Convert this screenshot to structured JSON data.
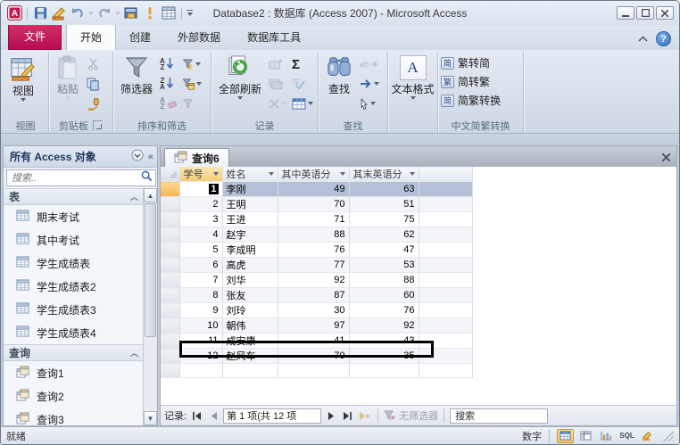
{
  "window": {
    "title": "Database2 : 数据库 (Access 2007)  -  Microsoft Access"
  },
  "qat_icons": [
    "access-logo",
    "save",
    "design-view",
    "undo",
    "redo",
    "switch-windows",
    "run",
    "datasheet-view",
    "customize-qat"
  ],
  "tabs": {
    "file": "文件",
    "items": [
      "开始",
      "创建",
      "外部数据",
      "数据库工具"
    ],
    "active": "开始"
  },
  "ribbon": {
    "views": {
      "button": "视图",
      "label": "视图"
    },
    "clipboard": {
      "paste": "粘贴",
      "label": "剪贴板"
    },
    "sort_filter": {
      "filter": "筛选器",
      "label": "排序和筛选"
    },
    "records": {
      "refresh": "全部刷新",
      "label": "记录",
      "sigma": "Σ"
    },
    "find": {
      "find": "查找",
      "label": "查找",
      "replace": "ab"
    },
    "text_format": {
      "button": "文本格式",
      "letter": "A"
    },
    "chinese": {
      "t2s": "繁转简",
      "s2t": "简转繁",
      "convert": "简繁转换",
      "label": "中文简繁转换",
      "icon_t2s": "简",
      "icon_s2t": "繁",
      "icon_convert": "简"
    }
  },
  "nav_pane": {
    "header": "所有 Access 对象",
    "search_placeholder": "搜索..",
    "sections": [
      {
        "label": "表",
        "icon": "table",
        "items": [
          "期末考试",
          "其中考试",
          "学生成绩表",
          "学生成绩表2",
          "学生成绩表3",
          "学生成绩表4"
        ]
      },
      {
        "label": "查询",
        "icon": "query",
        "items": [
          "查询1",
          "查询2",
          "查询3"
        ]
      }
    ]
  },
  "document": {
    "tab_label": "查询6",
    "columns": [
      "学号",
      "姓名",
      "其中英语分",
      "其末英语分"
    ],
    "rows": [
      [
        1,
        "李刚",
        49,
        63
      ],
      [
        2,
        "王明",
        70,
        51
      ],
      [
        3,
        "王进",
        71,
        75
      ],
      [
        4,
        "赵宇",
        88,
        62
      ],
      [
        5,
        "李成明",
        76,
        47
      ],
      [
        6,
        "高虎",
        77,
        53
      ],
      [
        7,
        "刘华",
        92,
        88
      ],
      [
        8,
        "张友",
        87,
        60
      ],
      [
        9,
        "刘玲",
        30,
        76
      ],
      [
        10,
        "朝伟",
        97,
        92
      ],
      [
        11,
        "成安康",
        41,
        43
      ],
      [
        12,
        "赵风车",
        70,
        35
      ]
    ],
    "selected_row_index": 0,
    "annotated_row_index": 11
  },
  "record_nav": {
    "label": "记录:",
    "position": "第 1 项(共 12 项",
    "no_filter": "无筛选器",
    "search_value": "搜索"
  },
  "status_bar": {
    "ready": "就绪",
    "num_lock": "数字",
    "sql": "SQL"
  }
}
